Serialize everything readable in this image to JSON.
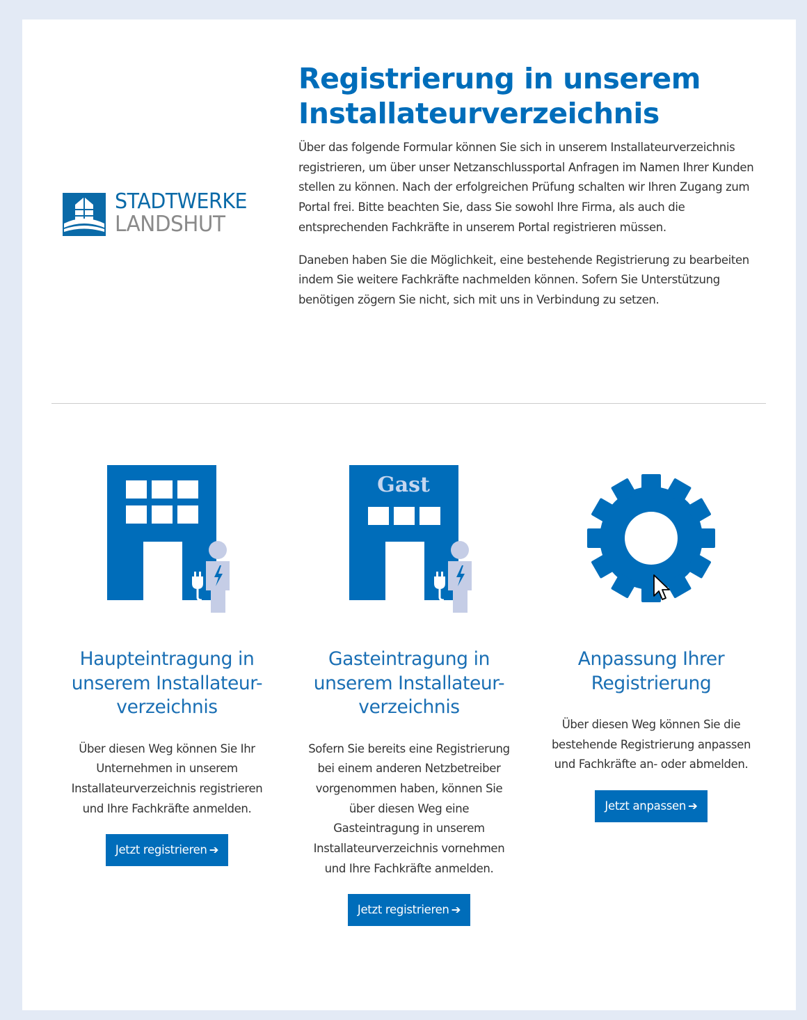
{
  "logo": {
    "line1": "STADTWERKE",
    "line2": "LANDSHUT"
  },
  "intro": {
    "title": "Registrierung in unserem Installateurverzeichnis",
    "paragraph1": "Über das folgende Formular können Sie sich in unserem Installateurverzeichnis registrieren, um über unser Netzanschlussportal Anfragen im Namen Ihrer Kunden stellen zu können. Nach der erfolgreichen Prüfung schalten wir Ihren Zugang zum Portal frei. Bitte beachten Sie, dass Sie sowohl Ihre Firma, als auch die entsprechenden Fachkräfte in unserem Portal registrieren müssen.",
    "paragraph2": "Daneben haben Sie die Möglichkeit, eine bestehende Registrierung zu bearbeiten indem Sie weitere Fachkräfte nachmelden können. Sofern Sie Unterstützung benötigen zögern Sie nicht, sich mit uns in Verbindung zu setzen."
  },
  "options": [
    {
      "icon": "building-electrician-icon",
      "title": "Haupteintragung in unserem Installateur-verzeichnis",
      "text": "Über diesen Weg können Sie Ihr Unternehmen in unserem Installateurverzeichnis registrieren und Ihre Fachkräfte anmelden.",
      "button": "Jetzt registrieren"
    },
    {
      "icon": "guest-building-electrician-icon",
      "icon_label": "Gast",
      "title": "Gasteintragung in unserem Installateur-verzeichnis",
      "text": "Sofern Sie bereits eine Registrierung bei einem anderen Netzbetreiber vorgenommen haben, können Sie über diesen Weg eine Gasteintragung in unserem Installateurverzeichnis vornehmen und Ihre Fachkräfte anmelden.",
      "button": "Jetzt registrieren"
    },
    {
      "icon": "gear-icon",
      "title": "Anpassung Ihrer Registrierung",
      "text": "Über diesen Weg können Sie die bestehende Registrierung anpassen und Fachkräfte an- oder abmelden.",
      "button": "Jetzt anpassen"
    }
  ],
  "colors": {
    "brand_blue": "#006dba",
    "light_figure": "#c5cde6",
    "background": "#e3eaf5"
  }
}
